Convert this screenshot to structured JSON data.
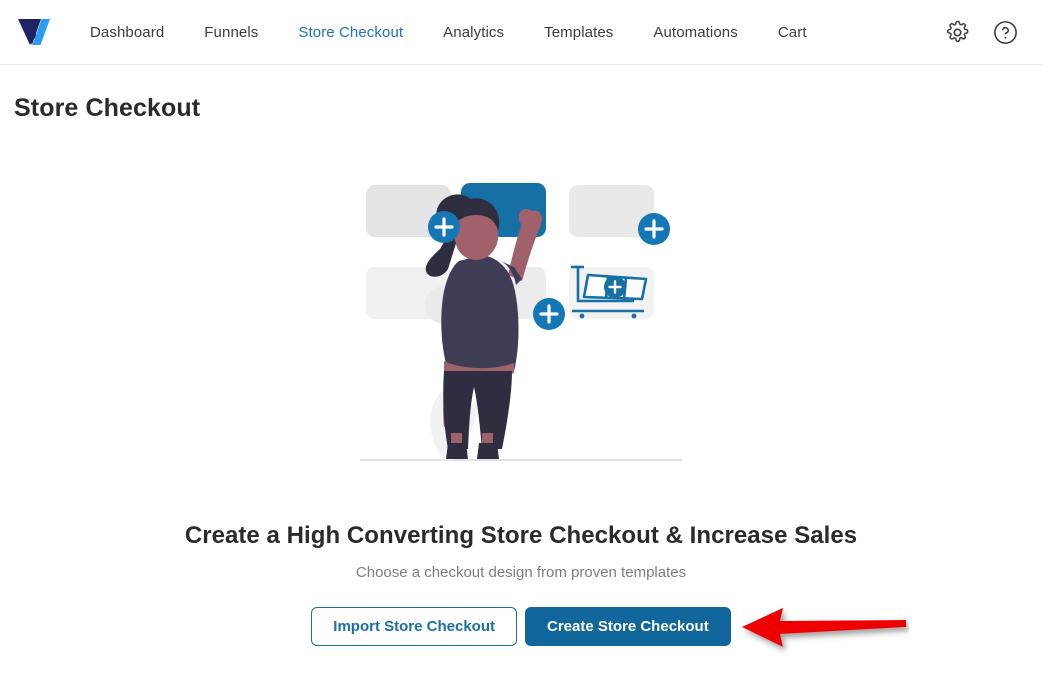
{
  "app": {
    "logo_icon": "cartflows-v-logo",
    "brand_navy": "#1d2562",
    "brand_blue": "#2b9cf4"
  },
  "nav": {
    "items": [
      {
        "label": "Dashboard",
        "active": false
      },
      {
        "label": "Funnels",
        "active": false
      },
      {
        "label": "Store Checkout",
        "active": true
      },
      {
        "label": "Analytics",
        "active": false
      },
      {
        "label": "Templates",
        "active": false
      },
      {
        "label": "Automations",
        "active": false
      },
      {
        "label": "Cart",
        "active": false
      }
    ],
    "active_color": "#1a73c8",
    "settings_icon": "gear-icon",
    "help_icon": "question-circle-icon"
  },
  "page": {
    "title": "Store Checkout"
  },
  "empty_state": {
    "illustration_icon": "woman-arranging-checkout-cards-illustration",
    "cart_icon": "add-to-cart-icon",
    "add_icon": "plus-circle-icon",
    "headline": "Create a High Converting Store Checkout & Increase Sales",
    "subhead": "Choose a checkout design from proven templates",
    "import_button": "Import Store Checkout",
    "create_button": "Create Store Checkout",
    "primary_color": "#11679b",
    "outline_color": "#1a6ea3"
  },
  "annotation": {
    "arrow_icon": "red-left-arrow-annotation",
    "arrow_color": "#ee0000",
    "points_to": "Create Store Checkout"
  }
}
